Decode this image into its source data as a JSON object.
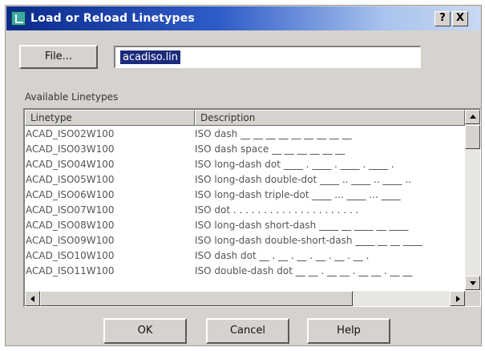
{
  "window": {
    "title": "Load or Reload Linetypes",
    "help_label": "?",
    "close_label": "X"
  },
  "file": {
    "button_label": "File...",
    "value": "acadiso.lin"
  },
  "list": {
    "group_label": "Available Linetypes",
    "columns": [
      "Linetype",
      "Description"
    ],
    "rows": [
      {
        "linetype": "ACAD_ISO02W100",
        "description": "ISO dash",
        "pattern": "__ __ __ __ __ __ __ __ __"
      },
      {
        "linetype": "ACAD_ISO03W100",
        "description": "ISO dash space",
        "pattern": "__   __   __   __   __   __"
      },
      {
        "linetype": "ACAD_ISO04W100",
        "description": "ISO long-dash dot",
        "pattern": "____ . ____ . ____ . ____ ."
      },
      {
        "linetype": "ACAD_ISO05W100",
        "description": "ISO long-dash double-dot",
        "pattern": "____ .. ____ .. ____ .."
      },
      {
        "linetype": "ACAD_ISO06W100",
        "description": "ISO long-dash triple-dot",
        "pattern": "____ ... ____ ... ____"
      },
      {
        "linetype": "ACAD_ISO07W100",
        "description": "ISO dot",
        "pattern": ". . . . . . . . . . . . . . . . . . . . ."
      },
      {
        "linetype": "ACAD_ISO08W100",
        "description": "ISO long-dash short-dash",
        "pattern": "____ __ ____ __ ____"
      },
      {
        "linetype": "ACAD_ISO09W100",
        "description": "ISO long-dash double-short-dash",
        "pattern": "____ __ __ ____"
      },
      {
        "linetype": "ACAD_ISO10W100",
        "description": "ISO dash dot",
        "pattern": "__ . __ . __ . __ . __ . __ ."
      },
      {
        "linetype": "ACAD_ISO11W100",
        "description": "ISO double-dash dot",
        "pattern": "__ __ . __ __ . __ __ . __ __"
      }
    ]
  },
  "buttons": {
    "ok": "OK",
    "cancel": "Cancel",
    "help": "Help"
  },
  "colors": {
    "title_gradient_start": "#0a2a8a",
    "title_gradient_end": "#c9d8f2",
    "dialog_face": "#d6d3ce",
    "selection": "#1c2a7c"
  },
  "icons": {
    "app": "autocad-app-icon",
    "scroll_up": "arrow-up-icon",
    "scroll_down": "arrow-down-icon",
    "scroll_left": "arrow-left-icon",
    "scroll_right": "arrow-right-icon"
  }
}
